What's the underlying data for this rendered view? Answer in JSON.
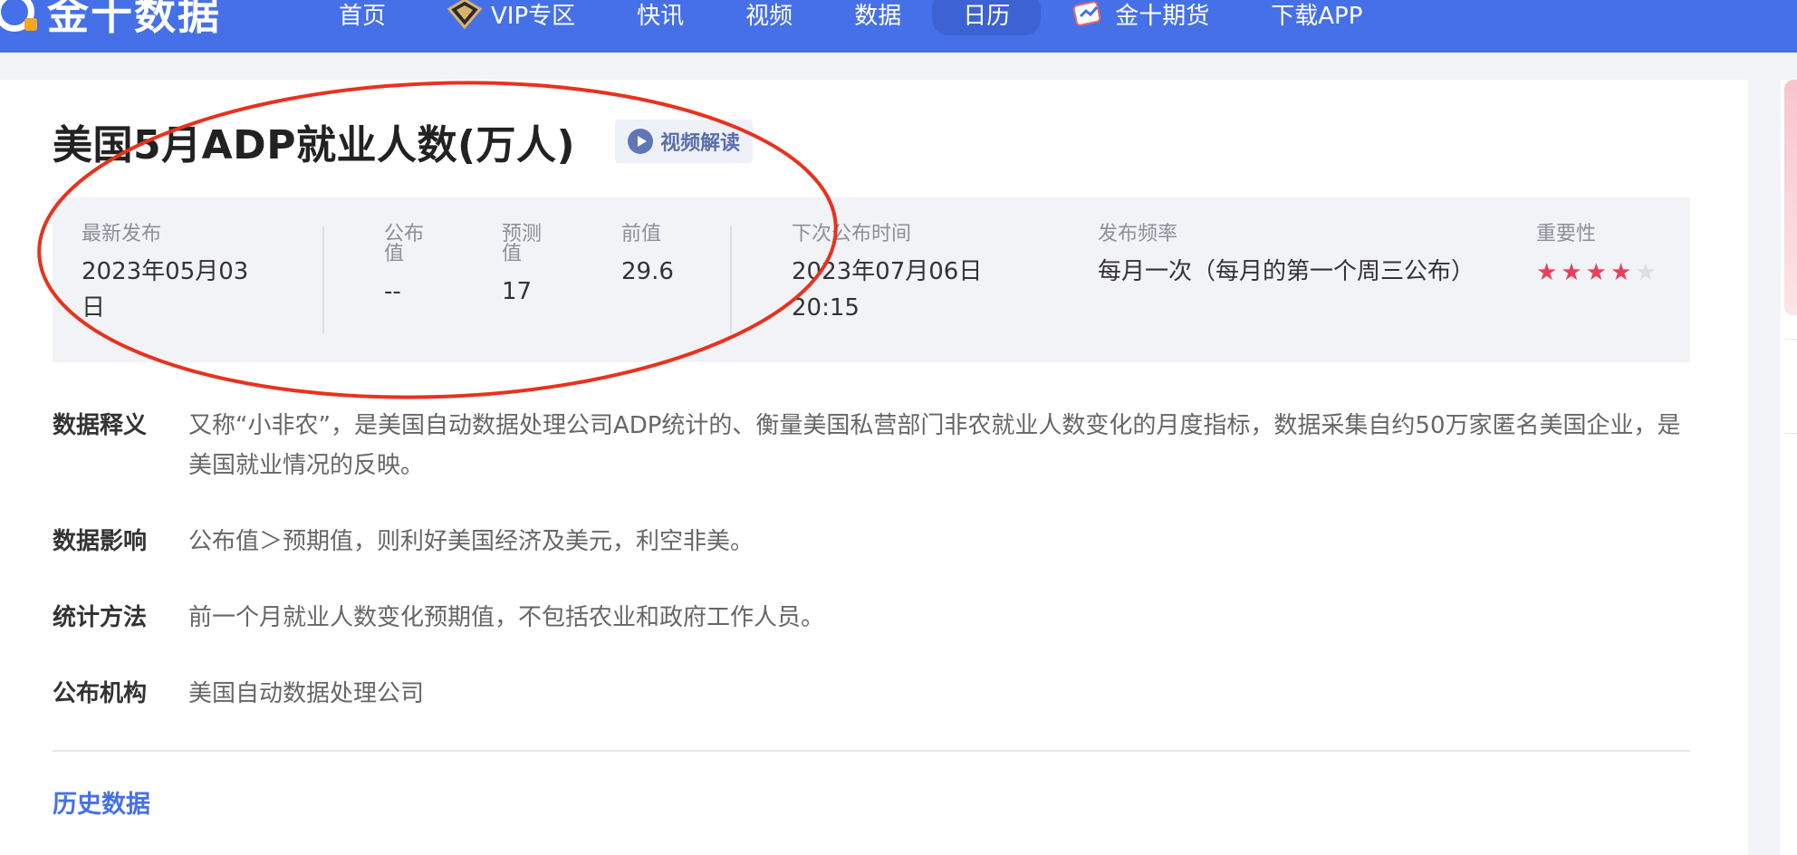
{
  "nav": {
    "logo_text": "金十数据",
    "items": [
      {
        "label": "首页"
      },
      {
        "label": "VIP专区"
      },
      {
        "label": "快讯"
      },
      {
        "label": "视频"
      },
      {
        "label": "数据"
      },
      {
        "label": "日历"
      },
      {
        "label": "金十期货"
      },
      {
        "label": "下载APP"
      }
    ],
    "active": "日历"
  },
  "page": {
    "title": "美国5月ADP就业人数(万人)",
    "video_label": "视频解读"
  },
  "info": {
    "latest_label": "最新发布",
    "latest_value": "2023年05月03日",
    "actual_label": "公布值",
    "actual_value": "--",
    "forecast_label": "预测值",
    "forecast_value": "17",
    "previous_label": "前值",
    "previous_value": "29.6",
    "next_label": "下次公布时间",
    "next_value": "2023年07月06日 20:15",
    "freq_label": "发布频率",
    "freq_value": "每月一次（每月的第一个周三公布）",
    "importance_label": "重要性",
    "importance_stars": 4,
    "importance_max": 5
  },
  "definitions": [
    {
      "key": "数据释义",
      "value": "又称“小非农”，是美国自动数据处理公司ADP统计的、衡量美国私营部门非农就业人数变化的月度指标，数据采集自约50万家匿名美国企业，是美国就业情况的反映。"
    },
    {
      "key": "数据影响",
      "value": "公布值＞预期值，则利好美国经济及美元，利空非美。"
    },
    {
      "key": "统计方法",
      "value": "前一个月就业人数变化预期值，不包括农业和政府工作人员。"
    },
    {
      "key": "公布机构",
      "value": "美国自动数据处理公司"
    }
  ],
  "history_label": "历史数据",
  "colors": {
    "nav_bg": "#4670e8",
    "accent": "#4670e8",
    "star": "#e8405a",
    "annotation": "#e8321e"
  }
}
